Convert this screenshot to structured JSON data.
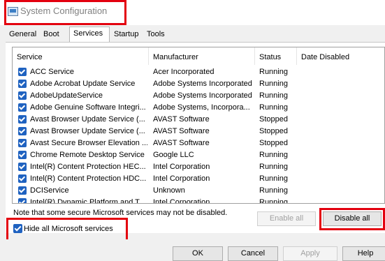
{
  "window": {
    "title": "System Configuration"
  },
  "tabs": [
    "General",
    "Boot",
    "Services",
    "Startup",
    "Tools"
  ],
  "active_tab": "Services",
  "table": {
    "columns": [
      "Service",
      "Manufacturer",
      "Status",
      "Date Disabled"
    ],
    "rows": [
      {
        "checked": true,
        "service": "ACC Service",
        "manufacturer": "Acer Incorporated",
        "status": "Running",
        "date_disabled": ""
      },
      {
        "checked": true,
        "service": "Adobe Acrobat Update Service",
        "manufacturer": "Adobe Systems Incorporated",
        "status": "Running",
        "date_disabled": ""
      },
      {
        "checked": true,
        "service": "AdobeUpdateService",
        "manufacturer": "Adobe Systems Incorporated",
        "status": "Running",
        "date_disabled": ""
      },
      {
        "checked": true,
        "service": "Adobe Genuine Software Integri...",
        "manufacturer": "Adobe Systems, Incorpora...",
        "status": "Running",
        "date_disabled": ""
      },
      {
        "checked": true,
        "service": "Avast Browser Update Service (...",
        "manufacturer": "AVAST Software",
        "status": "Stopped",
        "date_disabled": ""
      },
      {
        "checked": true,
        "service": "Avast Browser Update Service (...",
        "manufacturer": "AVAST Software",
        "status": "Stopped",
        "date_disabled": ""
      },
      {
        "checked": true,
        "service": "Avast Secure Browser Elevation ...",
        "manufacturer": "AVAST Software",
        "status": "Stopped",
        "date_disabled": ""
      },
      {
        "checked": true,
        "service": "Chrome Remote Desktop Service",
        "manufacturer": "Google LLC",
        "status": "Running",
        "date_disabled": ""
      },
      {
        "checked": true,
        "service": "Intel(R) Content Protection HEC...",
        "manufacturer": "Intel Corporation",
        "status": "Running",
        "date_disabled": ""
      },
      {
        "checked": true,
        "service": "Intel(R) Content Protection HDC...",
        "manufacturer": "Intel Corporation",
        "status": "Running",
        "date_disabled": ""
      },
      {
        "checked": true,
        "service": "DCIService",
        "manufacturer": "Unknown",
        "status": "Running",
        "date_disabled": ""
      },
      {
        "checked": true,
        "service": "Intel(R) Dynamic Platform and T...",
        "manufacturer": "Intel Corporation",
        "status": "Running",
        "date_disabled": ""
      }
    ]
  },
  "note": "Note that some secure Microsoft services may not be disabled.",
  "enable_all_label": "Enable all",
  "disable_all_label": "Disable all",
  "hide_ms": {
    "label": "Hide all Microsoft services",
    "checked": true
  },
  "buttons": {
    "ok": "OK",
    "cancel": "Cancel",
    "apply": "Apply",
    "help": "Help"
  },
  "colors": {
    "highlight": "#e3000f",
    "checkbox": "#1f62c0"
  }
}
